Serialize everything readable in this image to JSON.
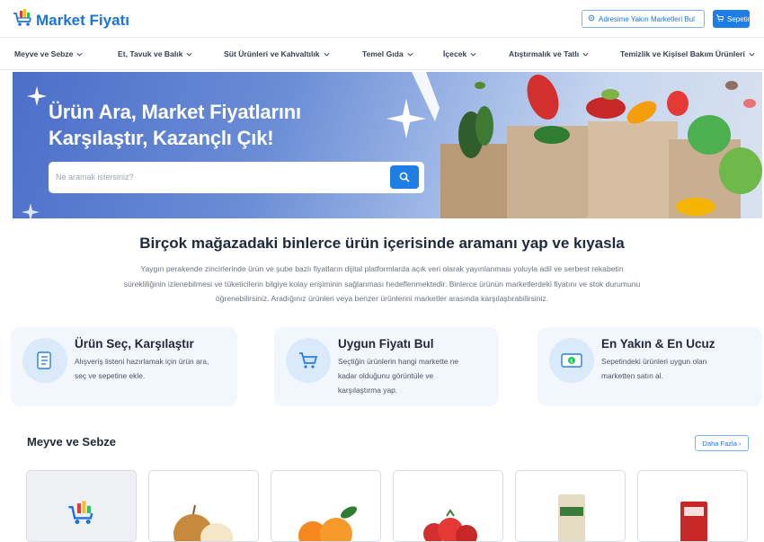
{
  "header": {
    "logo_text": "Market Fiyatı",
    "nearby_button": "Adresime Yakın Marketleri Bul",
    "cart_button": "Sepetim"
  },
  "nav": {
    "items": [
      {
        "label": "Meyve ve Sebze"
      },
      {
        "label": "Et, Tavuk ve Balık"
      },
      {
        "label": "Süt Ürünleri ve Kahvaltılık"
      },
      {
        "label": "Temel Gıda"
      },
      {
        "label": "İçecek"
      },
      {
        "label": "Atıştırmalık ve Tatlı"
      },
      {
        "label": "Temizlik ve Kişisel Bakım Ürünleri"
      }
    ]
  },
  "hero": {
    "title_line1": "Ürün Ara, Market Fiyatlarını",
    "title_line2": "Karşılaştır, Kazançlı Çık!",
    "search_placeholder": "Ne aramak istersiniz?"
  },
  "intro": {
    "title": "Birçok mağazadaki binlerce ürün içerisinde aramanı yap ve kıyasla",
    "desc_line1": "Yaygın perakende zincirlerinde ürün ve şube bazlı fiyatların dijital platformlarda açık veri olarak yayınlanması yoluyla adil ve serbest rekabetin",
    "desc_line2": "sürekliliğinin izlenebilmesi ve tüketicilerin bilgiye kolay erişiminin sağlanması hedeflenmektedir. Binlerce ürünün marketlerdeki fiyatını ve stok durumunu",
    "desc_line3": "öğrenebilirsiniz. Aradığınız ürünleri veya benzer ürünlerini marketler arasında karşılaştırabilirsiniz."
  },
  "features": [
    {
      "title": "Ürün Seç, Karşılaştır",
      "line1": "Alışveriş listeni hazırlamak için ürün ara,",
      "line2": "seç ve sepetine ekle.",
      "line3": "",
      "icon": "list-icon"
    },
    {
      "title": "Uygun Fiyatı Bul",
      "line1": "Seçtiğin ürünlerin hangi markette ne",
      "line2": "kadar olduğunu görüntüle ve",
      "line3": "karşılaştırma yap.",
      "icon": "cart-icon"
    },
    {
      "title": "En Yakın & En Ucuz",
      "line1": "Sepetindeki ürünleri uygun olan",
      "line2": "marketten satın al.",
      "line3": "",
      "icon": "money-icon"
    }
  ],
  "category": {
    "title": "Meyve ve Sebze",
    "more_button": "Daha Fazla ›"
  },
  "products": [
    {
      "name": "placeholder-logo"
    },
    {
      "name": "onion"
    },
    {
      "name": "mandarin"
    },
    {
      "name": "tomato"
    },
    {
      "name": "packaged-product"
    },
    {
      "name": "packaged-red-product"
    }
  ],
  "colors": {
    "brand_blue": "#1e7ee6",
    "hero_left": "#4b6ec9",
    "card_bg": "#f2f7fd"
  }
}
